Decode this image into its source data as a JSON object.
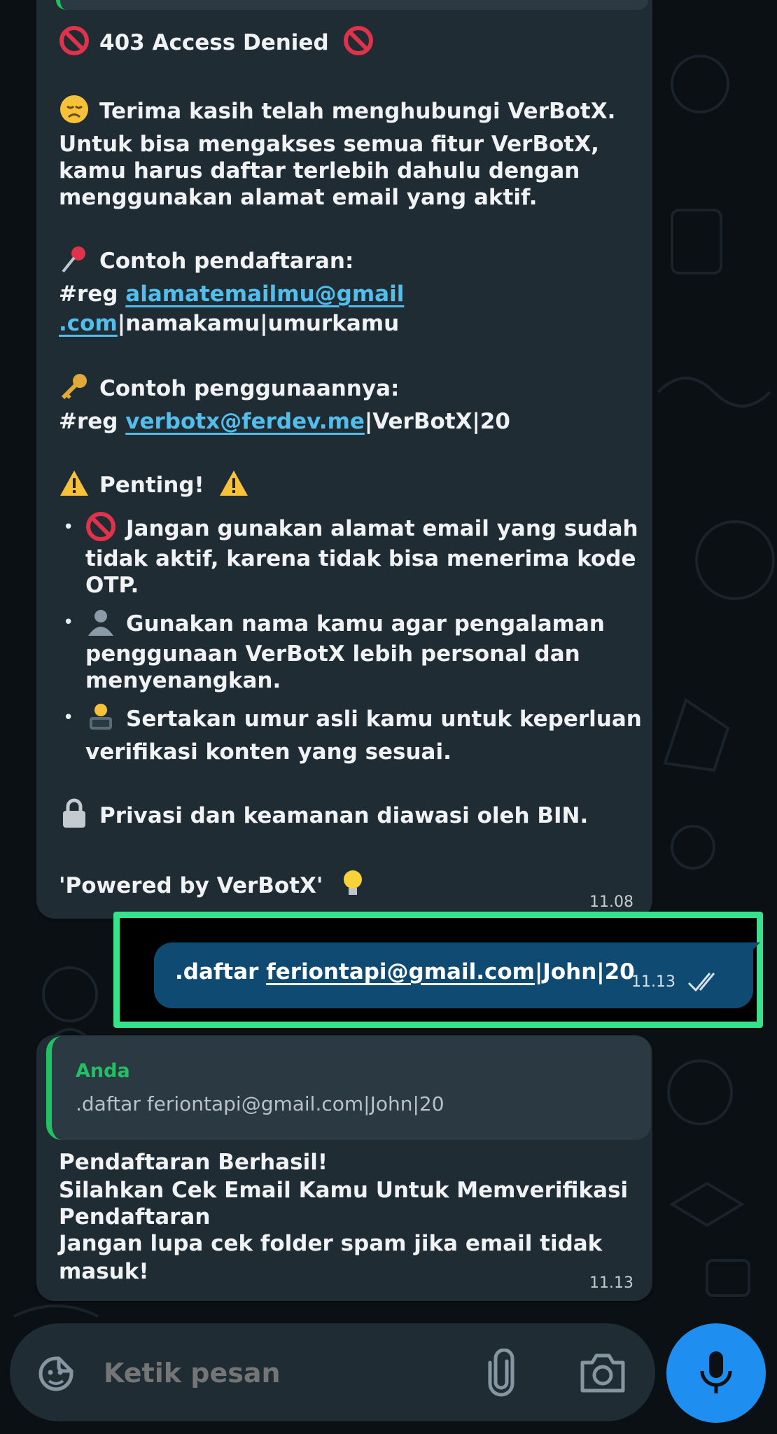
{
  "chat": {
    "message1": {
      "title": "403 Access Denied",
      "intro": "Terima kasih telah menghubungi VerBotX.",
      "para1": "Untuk bisa mengakses semua fitur VerBotX,",
      "para2": "kamu harus daftar terlebih dahulu dengan",
      "para3": "menggunakan alamat email yang aktif.",
      "example_heading": "Contoh pendaftaran:",
      "example_prefix": "#reg",
      "example_link_1": "alamatemailmu@gmail",
      "example_link_2": ".com",
      "example_suffix": "|namakamu|umurkamu",
      "usage_heading": "Contoh penggunaannya:",
      "usage_prefix": "#reg",
      "usage_link": "verbotx@ferdev.me",
      "usage_suffix": "|VerBotX|20",
      "important_heading": "Penting!",
      "bullet1_l1": "Jangan gunakan alamat email yang sudah",
      "bullet1_l2": "tidak aktif, karena tidak bisa menerima kode",
      "bullet1_l3": "OTP.",
      "bullet2_l1": "Gunakan nama kamu agar pengalaman",
      "bullet2_l2": "penggunaan VerBotX lebih personal dan",
      "bullet2_l3": "menyenangkan.",
      "bullet3_l1": "Sertakan umur asli kamu untuk keperluan",
      "bullet3_l2": "verifikasi konten yang sesuai.",
      "privacy": "Privasi dan keamanan diawasi oleh BIN.",
      "powered": "'Powered by VerBotX'",
      "time": "11.08"
    },
    "message2": {
      "prefix": ".daftar ",
      "link": "feriontapi@gmail.com",
      "suffix": "|John|20",
      "time": "11.13",
      "status_icon": "double-check-icon"
    },
    "message3": {
      "quote_author": "Anda",
      "quote_text": ".daftar feriontapi@gmail.com|John|20",
      "line1": "Pendaftaran Berhasil!",
      "line2": "Silahkan Cek Email Kamu Untuk Memverifikasi",
      "line3": "Pendaftaran",
      "line4": "Jangan lupa cek folder spam jika email tidak",
      "line5": "masuk!",
      "time": "11.13"
    }
  },
  "input_bar": {
    "placeholder": "Ketik pesan"
  },
  "colors": {
    "incoming_bubble": "#1f2c34",
    "outgoing_bubble": "#0f4a73",
    "highlight_border": "#34e38a",
    "link": "#53bdeb",
    "quote_bar": "#21c063",
    "mic_button": "#1e8ff0"
  }
}
